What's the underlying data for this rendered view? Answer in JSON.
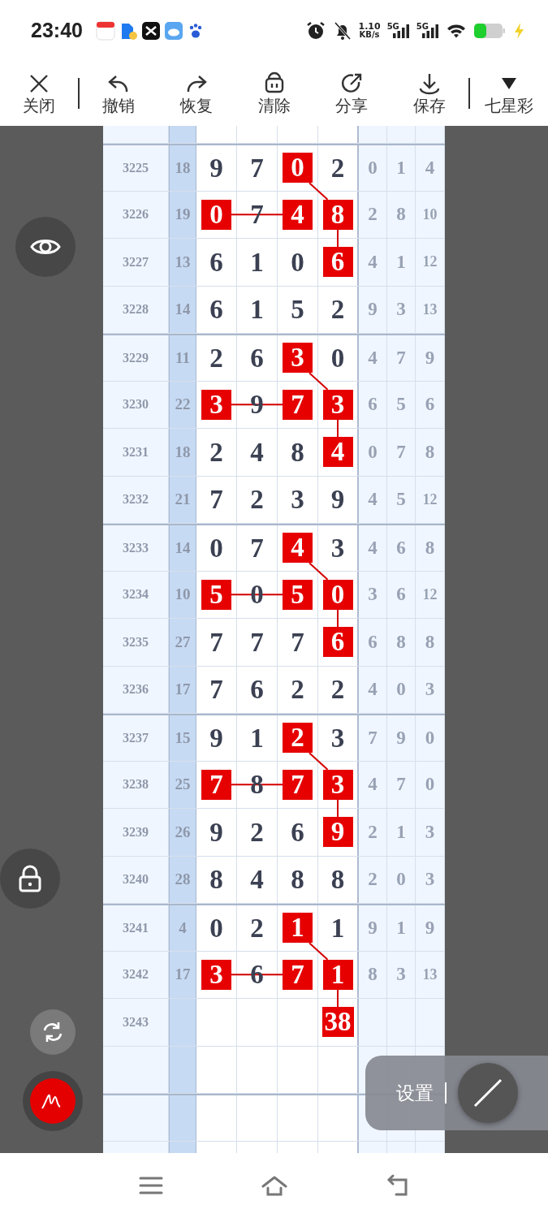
{
  "status_bar": {
    "time": "23:40",
    "net_speed": "1.10",
    "net_unit": "KB/s",
    "sim_1": "5G",
    "sim_2": "5G"
  },
  "toolbar": [
    {
      "kind": "close",
      "label": "关闭",
      "divider_before": false
    },
    {
      "kind": "undo",
      "label": "撤销",
      "divider_before": true
    },
    {
      "kind": "redo",
      "label": "恢复",
      "divider_before": false
    },
    {
      "kind": "clear",
      "label": "清除",
      "divider_before": false
    },
    {
      "kind": "share",
      "label": "分享",
      "divider_before": false
    },
    {
      "kind": "save",
      "label": "保存",
      "divider_before": false
    },
    {
      "kind": "dropdown",
      "label": "七星彩",
      "divider_before": true
    }
  ],
  "table": {
    "rows": [
      {
        "issue": "3225",
        "sum": "18",
        "digits": [
          {
            "value": "9",
            "highlighted": false,
            "kind": "single"
          },
          {
            "value": "7",
            "highlighted": false,
            "kind": "single"
          },
          {
            "value": "0",
            "highlighted": true,
            "kind": "diagonal"
          },
          {
            "value": "2",
            "highlighted": false,
            "kind": "single"
          }
        ],
        "extras": [
          "0",
          "1",
          "4"
        ]
      },
      {
        "issue": "3226",
        "sum": "19",
        "digits": [
          {
            "value": "0",
            "highlighted": true,
            "kind": "across"
          },
          {
            "value": "7",
            "highlighted": false,
            "kind": "single"
          },
          {
            "value": "4",
            "highlighted": true,
            "kind": "single"
          },
          {
            "value": "8",
            "highlighted": true,
            "kind": "down"
          }
        ],
        "extras": [
          "2",
          "8",
          "10"
        ]
      },
      {
        "issue": "3227",
        "sum": "13",
        "digits": [
          {
            "value": "6",
            "highlighted": false,
            "kind": "single"
          },
          {
            "value": "1",
            "highlighted": false,
            "kind": "single"
          },
          {
            "value": "0",
            "highlighted": false,
            "kind": "single"
          },
          {
            "value": "6",
            "highlighted": true,
            "kind": "single"
          }
        ],
        "extras": [
          "4",
          "1",
          "12"
        ]
      },
      {
        "issue": "3228",
        "sum": "14",
        "digits": [
          {
            "value": "6",
            "highlighted": false,
            "kind": "single"
          },
          {
            "value": "1",
            "highlighted": false,
            "kind": "single"
          },
          {
            "value": "5",
            "highlighted": false,
            "kind": "single"
          },
          {
            "value": "2",
            "highlighted": false,
            "kind": "single"
          }
        ],
        "extras": [
          "9",
          "3",
          "13"
        ]
      },
      {
        "issue": "3229",
        "sum": "11",
        "digits": [
          {
            "value": "2",
            "highlighted": false,
            "kind": "single"
          },
          {
            "value": "6",
            "highlighted": false,
            "kind": "single"
          },
          {
            "value": "3",
            "highlighted": true,
            "kind": "diagonal"
          },
          {
            "value": "0",
            "highlighted": false,
            "kind": "single"
          }
        ],
        "extras": [
          "4",
          "7",
          "9"
        ]
      },
      {
        "issue": "3230",
        "sum": "22",
        "digits": [
          {
            "value": "3",
            "highlighted": true,
            "kind": "across"
          },
          {
            "value": "9",
            "highlighted": false,
            "kind": "single"
          },
          {
            "value": "7",
            "highlighted": true,
            "kind": "single"
          },
          {
            "value": "3",
            "highlighted": true,
            "kind": "down"
          }
        ],
        "extras": [
          "6",
          "5",
          "6"
        ]
      },
      {
        "issue": "3231",
        "sum": "18",
        "digits": [
          {
            "value": "2",
            "highlighted": false,
            "kind": "single"
          },
          {
            "value": "4",
            "highlighted": false,
            "kind": "single"
          },
          {
            "value": "8",
            "highlighted": false,
            "kind": "single"
          },
          {
            "value": "4",
            "highlighted": true,
            "kind": "single"
          }
        ],
        "extras": [
          "0",
          "7",
          "8"
        ]
      },
      {
        "issue": "3232",
        "sum": "21",
        "digits": [
          {
            "value": "7",
            "highlighted": false,
            "kind": "single"
          },
          {
            "value": "2",
            "highlighted": false,
            "kind": "single"
          },
          {
            "value": "3",
            "highlighted": false,
            "kind": "single"
          },
          {
            "value": "9",
            "highlighted": false,
            "kind": "single"
          }
        ],
        "extras": [
          "4",
          "5",
          "12"
        ]
      },
      {
        "issue": "3233",
        "sum": "14",
        "digits": [
          {
            "value": "0",
            "highlighted": false,
            "kind": "single"
          },
          {
            "value": "7",
            "highlighted": false,
            "kind": "single"
          },
          {
            "value": "4",
            "highlighted": true,
            "kind": "diagonal"
          },
          {
            "value": "3",
            "highlighted": false,
            "kind": "single"
          }
        ],
        "extras": [
          "4",
          "6",
          "8"
        ]
      },
      {
        "issue": "3234",
        "sum": "10",
        "digits": [
          {
            "value": "5",
            "highlighted": true,
            "kind": "across"
          },
          {
            "value": "0",
            "highlighted": false,
            "kind": "single"
          },
          {
            "value": "5",
            "highlighted": true,
            "kind": "single"
          },
          {
            "value": "0",
            "highlighted": true,
            "kind": "down"
          }
        ],
        "extras": [
          "3",
          "6",
          "12"
        ]
      },
      {
        "issue": "3235",
        "sum": "27",
        "digits": [
          {
            "value": "7",
            "highlighted": false,
            "kind": "single"
          },
          {
            "value": "7",
            "highlighted": false,
            "kind": "single"
          },
          {
            "value": "7",
            "highlighted": false,
            "kind": "single"
          },
          {
            "value": "6",
            "highlighted": true,
            "kind": "single"
          }
        ],
        "extras": [
          "6",
          "8",
          "8"
        ]
      },
      {
        "issue": "3236",
        "sum": "17",
        "digits": [
          {
            "value": "7",
            "highlighted": false,
            "kind": "single"
          },
          {
            "value": "6",
            "highlighted": false,
            "kind": "single"
          },
          {
            "value": "2",
            "highlighted": false,
            "kind": "single"
          },
          {
            "value": "2",
            "highlighted": false,
            "kind": "single"
          }
        ],
        "extras": [
          "4",
          "0",
          "3"
        ]
      },
      {
        "issue": "3237",
        "sum": "15",
        "digits": [
          {
            "value": "9",
            "highlighted": false,
            "kind": "single"
          },
          {
            "value": "1",
            "highlighted": false,
            "kind": "single"
          },
          {
            "value": "2",
            "highlighted": true,
            "kind": "diagonal"
          },
          {
            "value": "3",
            "highlighted": false,
            "kind": "single"
          }
        ],
        "extras": [
          "7",
          "9",
          "0"
        ]
      },
      {
        "issue": "3238",
        "sum": "25",
        "digits": [
          {
            "value": "7",
            "highlighted": true,
            "kind": "across"
          },
          {
            "value": "8",
            "highlighted": false,
            "kind": "single"
          },
          {
            "value": "7",
            "highlighted": true,
            "kind": "single"
          },
          {
            "value": "3",
            "highlighted": true,
            "kind": "down"
          }
        ],
        "extras": [
          "4",
          "7",
          "0"
        ]
      },
      {
        "issue": "3239",
        "sum": "26",
        "digits": [
          {
            "value": "9",
            "highlighted": false,
            "kind": "single"
          },
          {
            "value": "2",
            "highlighted": false,
            "kind": "single"
          },
          {
            "value": "6",
            "highlighted": false,
            "kind": "single"
          },
          {
            "value": "9",
            "highlighted": true,
            "kind": "single"
          }
        ],
        "extras": [
          "2",
          "1",
          "3"
        ]
      },
      {
        "issue": "3240",
        "sum": "28",
        "digits": [
          {
            "value": "8",
            "highlighted": false,
            "kind": "single"
          },
          {
            "value": "4",
            "highlighted": false,
            "kind": "single"
          },
          {
            "value": "8",
            "highlighted": false,
            "kind": "single"
          },
          {
            "value": "8",
            "highlighted": false,
            "kind": "single"
          }
        ],
        "extras": [
          "2",
          "0",
          "3"
        ]
      },
      {
        "issue": "3241",
        "sum": "4",
        "digits": [
          {
            "value": "0",
            "highlighted": false,
            "kind": "single"
          },
          {
            "value": "2",
            "highlighted": false,
            "kind": "single"
          },
          {
            "value": "1",
            "highlighted": true,
            "kind": "diagonal"
          },
          {
            "value": "1",
            "highlighted": false,
            "kind": "single"
          }
        ],
        "extras": [
          "9",
          "1",
          "9"
        ]
      },
      {
        "issue": "3242",
        "sum": "17",
        "digits": [
          {
            "value": "3",
            "highlighted": true,
            "kind": "across"
          },
          {
            "value": "6",
            "highlighted": false,
            "kind": "single"
          },
          {
            "value": "7",
            "highlighted": true,
            "kind": "single"
          },
          {
            "value": "1",
            "highlighted": true,
            "kind": "down"
          }
        ],
        "extras": [
          "8",
          "3",
          "13"
        ]
      },
      {
        "issue": "3243",
        "trailing_digits": [
          {
            "value": "38",
            "highlighted": true,
            "kind": "single"
          }
        ]
      }
    ]
  },
  "settings_panel": {
    "label": "设置"
  }
}
